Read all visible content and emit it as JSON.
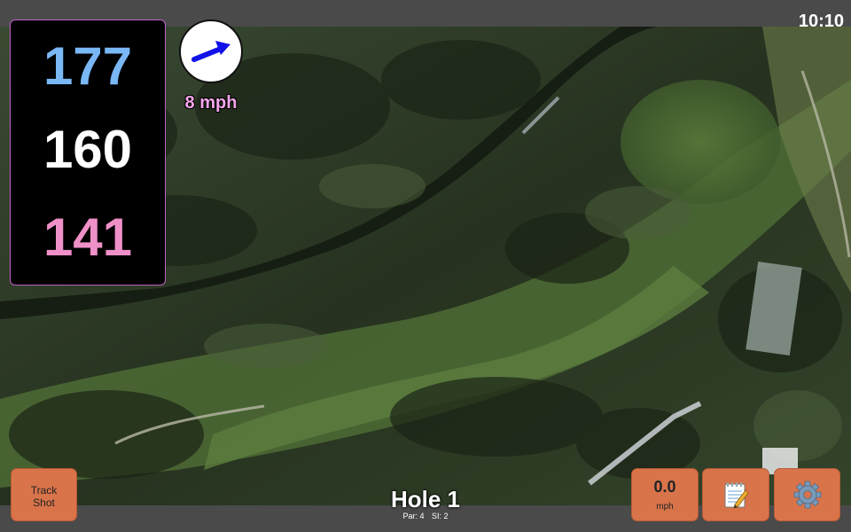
{
  "status_bar": {
    "time": "10:10"
  },
  "distances": {
    "back": "177",
    "middle": "160",
    "front": "141",
    "back_color": "#7ab8f5",
    "middle_color": "#ffffff",
    "front_color": "#f090c8"
  },
  "wind": {
    "speed_label": "8 mph",
    "direction_icon": "arrow-up-right-icon"
  },
  "hole": {
    "title": "Hole 1",
    "par": "Par: 4",
    "stroke_index": "SI: 2"
  },
  "buttons": {
    "track_shot_line1": "Track",
    "track_shot_line2": "Shot",
    "speed_value": "0.0",
    "speed_unit": "mph",
    "notes_icon": "notepad-icon",
    "settings_icon": "gear-icon"
  },
  "colors": {
    "button_bg": "#d9744a",
    "panel_border": "#c060c8",
    "bar_bg": "#4a4a4a"
  }
}
